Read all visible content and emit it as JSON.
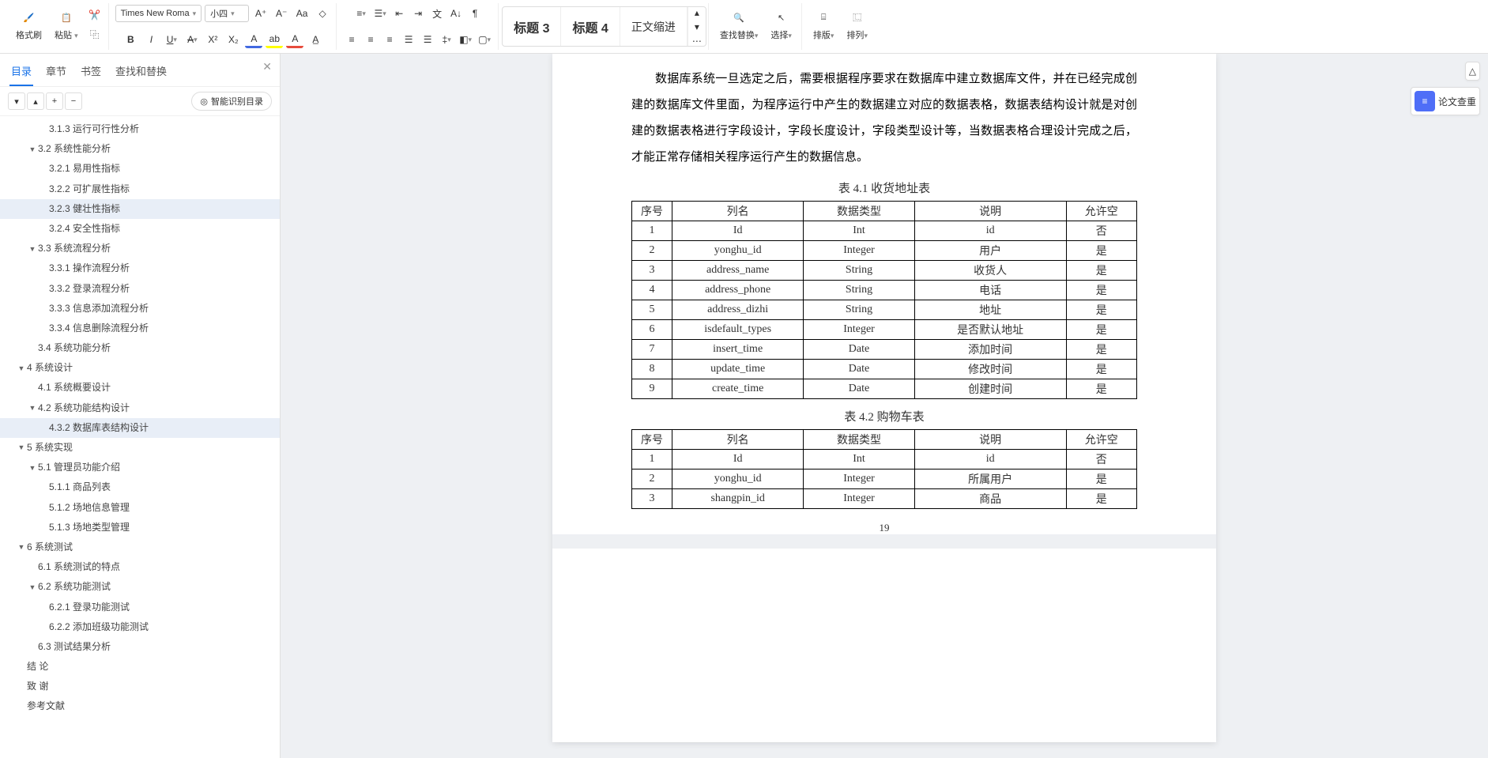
{
  "ribbon": {
    "format_painter": "格式刷",
    "paste": "粘贴",
    "font_name": "Times New Roma",
    "font_size": "小四",
    "styles": {
      "h3": "标题 3",
      "h4": "标题 4",
      "body": "正文缩进"
    },
    "find_replace": "查找替换",
    "select": "选择",
    "layout": "排版",
    "arrange": "排列"
  },
  "sidebar": {
    "tabs": {
      "toc": "目录",
      "chapter": "章节",
      "bookmark": "书签",
      "find": "查找和替换"
    },
    "smart": "智能识别目录",
    "items": [
      {
        "indent": 3,
        "arrow": "",
        "num": "3.1.3",
        "text": "运行可行性分析"
      },
      {
        "indent": 2,
        "arrow": "▼",
        "num": "3.2",
        "text": "系统性能分析"
      },
      {
        "indent": 3,
        "arrow": "",
        "num": "3.2.1",
        "text": "易用性指标"
      },
      {
        "indent": 3,
        "arrow": "",
        "num": "3.2.2",
        "text": "可扩展性指标"
      },
      {
        "indent": 3,
        "arrow": "",
        "num": "3.2.3",
        "text": "健壮性指标",
        "sel": true
      },
      {
        "indent": 3,
        "arrow": "",
        "num": "3.2.4",
        "text": "安全性指标"
      },
      {
        "indent": 2,
        "arrow": "▼",
        "num": "3.3",
        "text": "系统流程分析"
      },
      {
        "indent": 3,
        "arrow": "",
        "num": "3.3.1",
        "text": "操作流程分析"
      },
      {
        "indent": 3,
        "arrow": "",
        "num": "3.3.2",
        "text": "登录流程分析"
      },
      {
        "indent": 3,
        "arrow": "",
        "num": "3.3.3",
        "text": "信息添加流程分析"
      },
      {
        "indent": 3,
        "arrow": "",
        "num": "3.3.4",
        "text": "信息删除流程分析"
      },
      {
        "indent": 2,
        "arrow": "",
        "num": "3.4",
        "text": "系统功能分析"
      },
      {
        "indent": 1,
        "arrow": "▼",
        "num": "4",
        "text": "系统设计"
      },
      {
        "indent": 2,
        "arrow": "",
        "num": "4.1",
        "text": "系统概要设计"
      },
      {
        "indent": 2,
        "arrow": "▼",
        "num": "4.2",
        "text": "系统功能结构设计"
      },
      {
        "indent": 3,
        "arrow": "",
        "num": "4.3.2",
        "text": "数据库表结构设计",
        "sel": true
      },
      {
        "indent": 1,
        "arrow": "▼",
        "num": "5",
        "text": "系统实现"
      },
      {
        "indent": 2,
        "arrow": "▼",
        "num": "5.1",
        "text": "管理员功能介绍"
      },
      {
        "indent": 3,
        "arrow": "",
        "num": "5.1.1",
        "text": "商品列表"
      },
      {
        "indent": 3,
        "arrow": "",
        "num": "5.1.2",
        "text": "场地信息管理"
      },
      {
        "indent": 3,
        "arrow": "",
        "num": "5.1.3",
        "text": "场地类型管理"
      },
      {
        "indent": 1,
        "arrow": "▼",
        "num": "6",
        "text": "系统测试"
      },
      {
        "indent": 2,
        "arrow": "",
        "num": "6.1",
        "text": "系统测试的特点"
      },
      {
        "indent": 2,
        "arrow": "▼",
        "num": "6.2",
        "text": "系统功能测试"
      },
      {
        "indent": 3,
        "arrow": "",
        "num": "6.2.1",
        "text": "登录功能测试"
      },
      {
        "indent": 3,
        "arrow": "",
        "num": "6.2.2",
        "text": "添加班级功能测试"
      },
      {
        "indent": 2,
        "arrow": "",
        "num": "6.3",
        "text": "测试结果分析"
      },
      {
        "indent": 1,
        "arrow": "",
        "num": "",
        "text": "结  论"
      },
      {
        "indent": 1,
        "arrow": "",
        "num": "",
        "text": "致  谢"
      },
      {
        "indent": 1,
        "arrow": "",
        "num": "",
        "text": "参考文献"
      }
    ]
  },
  "doc": {
    "para": "数据库系统一旦选定之后，需要根据程序要求在数据库中建立数据库文件，并在已经完成创建的数据库文件里面，为程序运行中产生的数据建立对应的数据表格，数据表结构设计就是对创建的数据表格进行字段设计，字段长度设计，字段类型设计等，当数据表格合理设计完成之后，才能正常存储相关程序运行产生的数据信息。",
    "t1_caption": "表 4.1 收货地址表",
    "t1_head": [
      "序号",
      "列名",
      "数据类型",
      "说明",
      "允许空"
    ],
    "t1_rows": [
      [
        "1",
        "Id",
        "Int",
        "id",
        "否"
      ],
      [
        "2",
        "yonghu_id",
        "Integer",
        "用户",
        "是"
      ],
      [
        "3",
        "address_name",
        "String",
        "收货人",
        "是"
      ],
      [
        "4",
        "address_phone",
        "String",
        "电话",
        "是"
      ],
      [
        "5",
        "address_dizhi",
        "String",
        "地址",
        "是"
      ],
      [
        "6",
        "isdefault_types",
        "Integer",
        "是否默认地址",
        "是"
      ],
      [
        "7",
        "insert_time",
        "Date",
        "添加时间",
        "是"
      ],
      [
        "8",
        "update_time",
        "Date",
        "修改时间",
        "是"
      ],
      [
        "9",
        "create_time",
        "Date",
        "创建时间",
        "是"
      ]
    ],
    "t2_caption": "表 4.2 购物车表",
    "t2_head": [
      "序号",
      "列名",
      "数据类型",
      "说明",
      "允许空"
    ],
    "t2_rows": [
      [
        "1",
        "Id",
        "Int",
        "id",
        "否"
      ],
      [
        "2",
        "yonghu_id",
        "Integer",
        "所属用户",
        "是"
      ],
      [
        "3",
        "shangpin_id",
        "Integer",
        "商品",
        "是"
      ]
    ],
    "pagenum": "19"
  },
  "rail": {
    "paper_check": "论文查重"
  }
}
